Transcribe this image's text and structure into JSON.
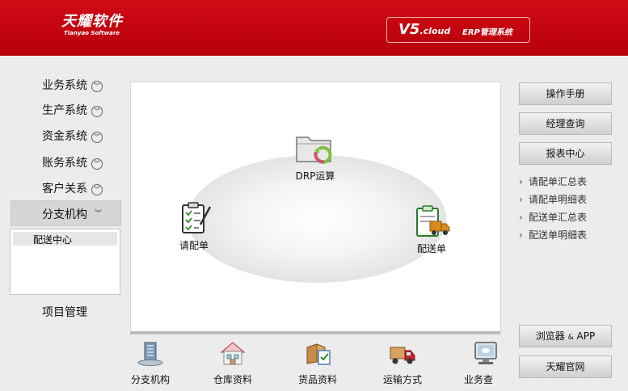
{
  "header": {
    "logo_main": "天耀软件",
    "logo_sub": "Tianyao Software",
    "version": "V5",
    "version_suffix": ".cloud",
    "system_name": "ERP管理系统"
  },
  "menu": {
    "items": [
      {
        "label": "业务系统"
      },
      {
        "label": "生产系统"
      },
      {
        "label": "资金系统"
      },
      {
        "label": "账务系统"
      },
      {
        "label": "客户关系"
      }
    ],
    "active": {
      "label": "分支机构"
    },
    "submenu": [
      {
        "label": "配送中心"
      }
    ],
    "project": "项目管理"
  },
  "diagram": {
    "top_node": "DRP运算",
    "left_node": "请配单",
    "right_node": "配送单"
  },
  "toolbar": [
    {
      "label": "分支机构",
      "icon": "branch-office-icon"
    },
    {
      "label": "仓库资料",
      "icon": "warehouse-icon"
    },
    {
      "label": "货品资料",
      "icon": "goods-icon"
    },
    {
      "label": "运输方式",
      "icon": "truck-icon"
    },
    {
      "label": "业务查",
      "icon": "monitor-icon"
    }
  ],
  "right": {
    "manual": "操作手册",
    "manager_query": "经理查询",
    "report_center": "报表中心",
    "reports": [
      {
        "label": "请配单汇总表"
      },
      {
        "label": "请配单明细表"
      },
      {
        "label": "配送单汇总表"
      },
      {
        "label": "配送单明细表"
      }
    ],
    "browser_app_1": "浏览器",
    "browser_app_amp": "&",
    "browser_app_2": "APP",
    "official_site": "天耀官网"
  },
  "colors": {
    "header_red": "#c4040f",
    "background": "#ececec"
  }
}
